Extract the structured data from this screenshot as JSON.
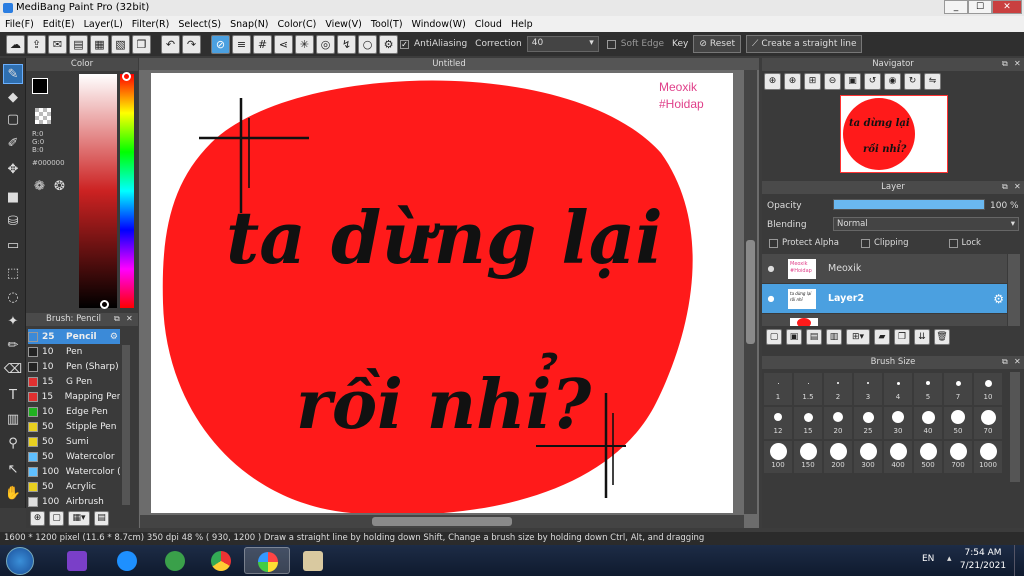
{
  "window": {
    "title": "MediBang Paint Pro (32bit)",
    "min": "_",
    "max": "☐",
    "close": "✕"
  },
  "menu": [
    "File(F)",
    "Edit(E)",
    "Layer(L)",
    "Filter(R)",
    "Select(S)",
    "Snap(N)",
    "Color(C)",
    "View(V)",
    "Tool(T)",
    "Window(W)",
    "Cloud",
    "Help"
  ],
  "toolbar": {
    "antialiasing_label": "AntiAliasing",
    "correction_label": "Correction",
    "correction_value": "40",
    "soft_edge_label": "Soft Edge",
    "key_label": "Key",
    "reset_label": "Reset",
    "straight_line_label": "Create a straight line"
  },
  "color_panel": {
    "title": "Color",
    "r": "R:0",
    "g": "G:0",
    "b": "B:0",
    "hex": "#000000",
    "fg": "#000000",
    "bg": "#ff2a2a"
  },
  "brush_panel": {
    "title": "Brush: Pencil",
    "items": [
      {
        "size": "25",
        "name": "Pencil",
        "color": "#3b8ad8"
      },
      {
        "size": "10",
        "name": "Pen",
        "color": "#222222"
      },
      {
        "size": "10",
        "name": "Pen (Sharp)",
        "color": "#222222"
      },
      {
        "size": "15",
        "name": "G Pen",
        "color": "#e03030"
      },
      {
        "size": "15",
        "name": "Mapping Pen",
        "color": "#e03030"
      },
      {
        "size": "10",
        "name": "Edge Pen",
        "color": "#20b020"
      },
      {
        "size": "50",
        "name": "Stipple Pen",
        "color": "#e8d020"
      },
      {
        "size": "50",
        "name": "Sumi",
        "color": "#e8d020"
      },
      {
        "size": "50",
        "name": "Watercolor",
        "color": "#60c0ff"
      },
      {
        "size": "100",
        "name": "Watercolor (",
        "color": "#60c0ff"
      },
      {
        "size": "50",
        "name": "Acrylic",
        "color": "#e8d020"
      },
      {
        "size": "100",
        "name": "Airbrush",
        "color": "#dddddd"
      }
    ]
  },
  "canvas": {
    "tab_title": "Untitled",
    "watermark_line1": "Meoxik",
    "watermark_line2": "#Hoidap",
    "text_line1": "ta dừng lại",
    "text_line2": "rồi nhỉ?",
    "circle_color": "#ff1a1a"
  },
  "navigator": {
    "title": "Navigator"
  },
  "layer_panel": {
    "title": "Layer",
    "opacity_label": "Opacity",
    "opacity_value": "100 %",
    "opacity_fraction": 1.0,
    "blending_label": "Blending",
    "blending_value": "Normal",
    "protect_alpha_label": "Protect Alpha",
    "clipping_label": "Clipping",
    "lock_label": "Lock",
    "layers": [
      {
        "name": "Meoxik",
        "thumb_l1": "Meoxik",
        "thumb_l2": "#Hoidap",
        "selected": false
      },
      {
        "name": "Layer2",
        "thumb_l1": "ta dừng lại",
        "thumb_l2": "rồi nhỉ",
        "selected": true
      }
    ]
  },
  "brush_size_panel": {
    "title": "Brush Size",
    "row1": [
      "1",
      "1.5",
      "2",
      "3",
      "4",
      "5",
      "7",
      "10"
    ],
    "row2": [
      "12",
      "15",
      "20",
      "25",
      "30",
      "40",
      "50",
      "70"
    ],
    "row3": [
      "100",
      "150",
      "200",
      "300",
      "400",
      "500",
      "700",
      "1000"
    ]
  },
  "status": {
    "text": "1600 * 1200 pixel   (11.6 * 8.7cm)   350 dpi   48 %   ( 930, 1200 )   Draw a straight line by holding down Shift, Change a brush size by holding down Ctrl, Alt, and dragging"
  },
  "taskbar": {
    "lang": "EN",
    "time": "7:54 AM",
    "date": "7/21/2021"
  }
}
